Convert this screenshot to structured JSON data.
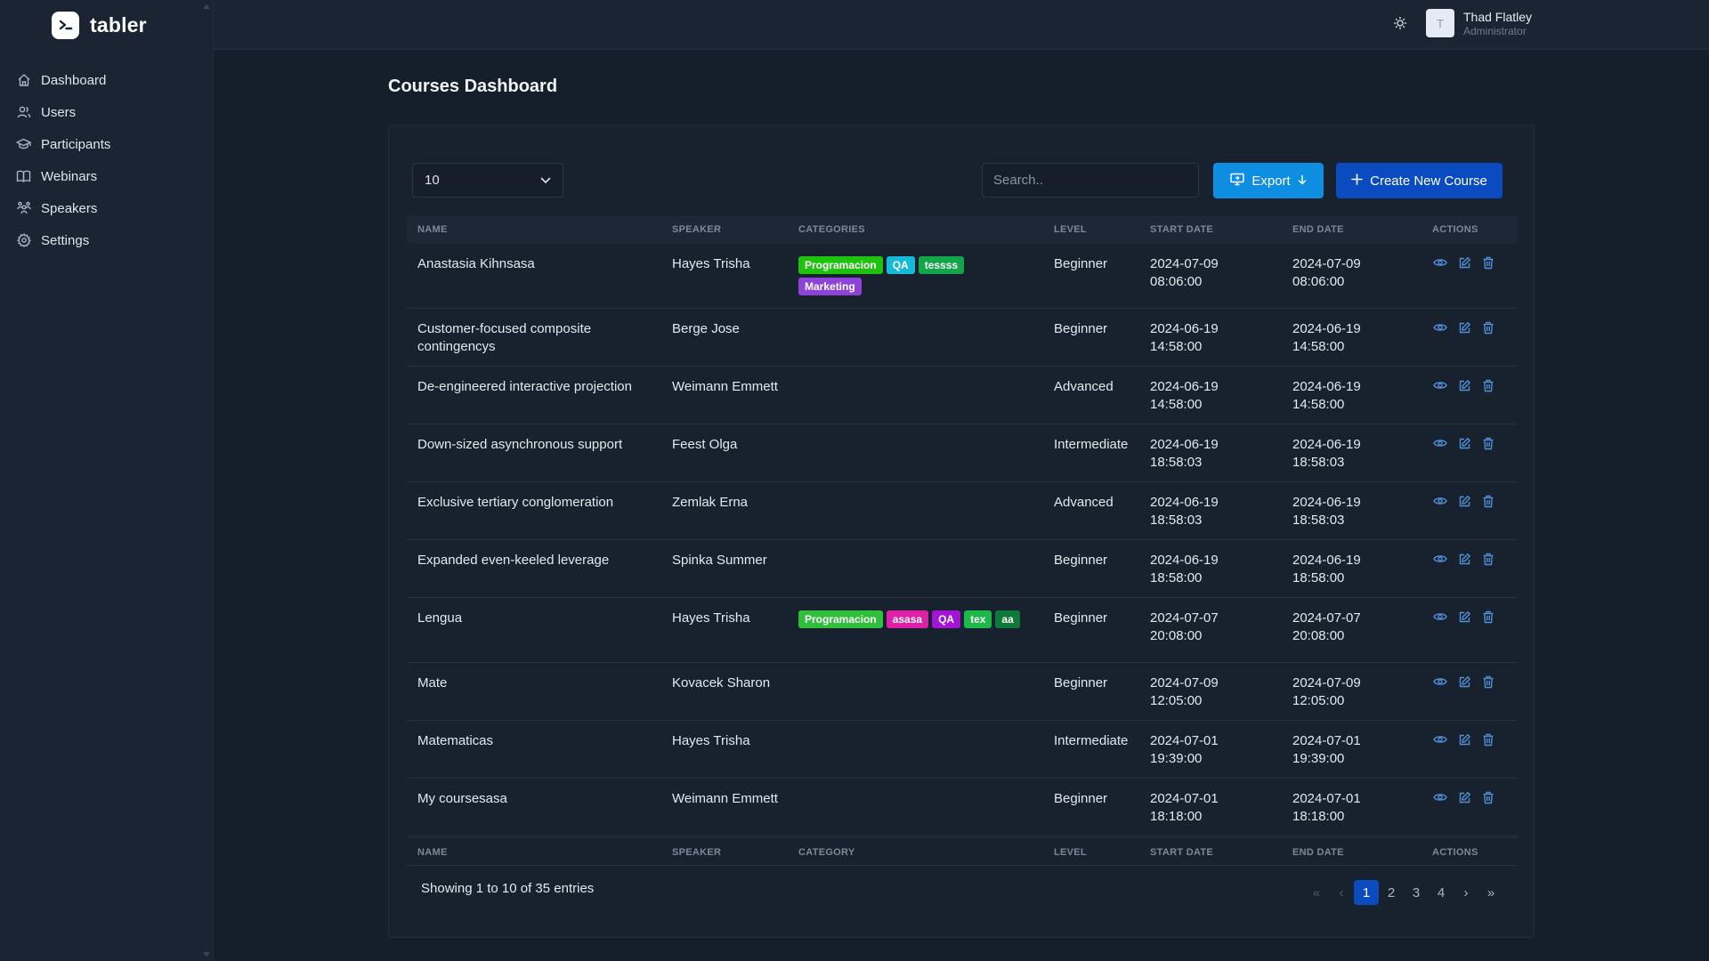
{
  "brand": {
    "name": "tabler"
  },
  "sidebar": {
    "items": [
      {
        "label": "Dashboard",
        "icon": "home-icon"
      },
      {
        "label": "Users",
        "icon": "users-icon"
      },
      {
        "label": "Participants",
        "icon": "graduation-cap-icon"
      },
      {
        "label": "Webinars",
        "icon": "book-icon"
      },
      {
        "label": "Speakers",
        "icon": "speakers-icon"
      },
      {
        "label": "Settings",
        "icon": "gear-icon"
      }
    ]
  },
  "header": {
    "user": {
      "initial": "T",
      "name": "Thad Flatley",
      "role": "Administrator"
    }
  },
  "page": {
    "title": "Courses Dashboard"
  },
  "toolbar": {
    "entries_value": "10",
    "search_placeholder": "Search..",
    "export_label": "Export",
    "create_label": "Create New Course"
  },
  "table": {
    "columns": [
      "NAME",
      "SPEAKER",
      "CATEGORIES",
      "LEVEL",
      "START DATE",
      "END DATE",
      "ACTIONS"
    ],
    "footer_columns": [
      "NAME",
      "SPEAKER",
      "CATEGORY",
      "LEVEL",
      "START DATE",
      "END DATE",
      "ACTIONS"
    ],
    "rows": [
      {
        "name": "Anastasia Kihnsasa",
        "speaker": "Hayes Trisha",
        "categories": [
          {
            "label": "Programacion",
            "color": "#1ec20f"
          },
          {
            "label": "QA",
            "color": "#17b9d9"
          },
          {
            "label": "tessss",
            "color": "#12a54a"
          },
          {
            "label": "Marketing",
            "color": "#8d43d6"
          }
        ],
        "level": "Beginner",
        "start_date": "2024-07-09",
        "start_time": "08:06:00",
        "end_date": "2024-07-09",
        "end_time": "08:06:00"
      },
      {
        "name": "Customer-focused composite contingencys",
        "speaker": "Berge Jose",
        "categories": [],
        "level": "Beginner",
        "start_date": "2024-06-19",
        "start_time": "14:58:00",
        "end_date": "2024-06-19",
        "end_time": "14:58:00"
      },
      {
        "name": "De-engineered interactive projection",
        "speaker": "Weimann Emmett",
        "categories": [],
        "level": "Advanced",
        "start_date": "2024-06-19",
        "start_time": "14:58:00",
        "end_date": "2024-06-19",
        "end_time": "14:58:00"
      },
      {
        "name": "Down-sized asynchronous support",
        "speaker": "Feest Olga",
        "categories": [],
        "level": "Intermediate",
        "start_date": "2024-06-19",
        "start_time": "18:58:03",
        "end_date": "2024-06-19",
        "end_time": "18:58:03"
      },
      {
        "name": "Exclusive tertiary conglomeration",
        "speaker": "Zemlak Erna",
        "categories": [],
        "level": "Advanced",
        "start_date": "2024-06-19",
        "start_time": "18:58:03",
        "end_date": "2024-06-19",
        "end_time": "18:58:03"
      },
      {
        "name": "Expanded even-keeled leverage",
        "speaker": "Spinka Summer",
        "categories": [],
        "level": "Beginner",
        "start_date": "2024-06-19",
        "start_time": "18:58:00",
        "end_date": "2024-06-19",
        "end_time": "18:58:00"
      },
      {
        "name": "Lengua",
        "speaker": "Hayes Trisha",
        "categories": [
          {
            "label": "Programacion",
            "color": "#2fbf3a"
          },
          {
            "label": "asasa",
            "color": "#e020a8"
          },
          {
            "label": "QA",
            "color": "#a314d6"
          },
          {
            "label": "tex",
            "color": "#1cb84a"
          },
          {
            "label": "aa",
            "color": "#0e7a3a"
          }
        ],
        "level": "Beginner",
        "start_date": "2024-07-07",
        "start_time": "20:08:00",
        "end_date": "2024-07-07",
        "end_time": "20:08:00"
      },
      {
        "name": "Mate",
        "speaker": "Kovacek Sharon",
        "categories": [],
        "level": "Beginner",
        "start_date": "2024-07-09",
        "start_time": "12:05:00",
        "end_date": "2024-07-09",
        "end_time": "12:05:00"
      },
      {
        "name": "Matematicas",
        "speaker": "Hayes Trisha",
        "categories": [],
        "level": "Intermediate",
        "start_date": "2024-07-01",
        "start_time": "19:39:00",
        "end_date": "2024-07-01",
        "end_time": "19:39:00"
      },
      {
        "name": "My coursesasa",
        "speaker": "Weimann Emmett",
        "categories": [],
        "level": "Beginner",
        "start_date": "2024-07-01",
        "start_time": "18:18:00",
        "end_date": "2024-07-01",
        "end_time": "18:18:00"
      }
    ]
  },
  "footer": {
    "showing": "Showing 1 to 10 of 35 entries",
    "pages": [
      "1",
      "2",
      "3",
      "4"
    ],
    "current_page": "1",
    "first": "«",
    "prev": "‹",
    "next": "›",
    "last": "»"
  },
  "colors": {
    "accent": "#0a4cbf",
    "export": "#0d8ee0",
    "action_icon": "#4f8fd6"
  }
}
